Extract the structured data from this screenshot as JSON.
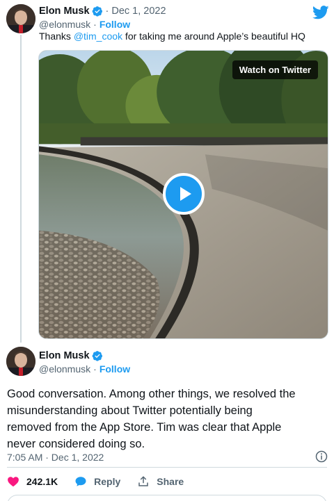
{
  "reply_tweet": {
    "author_name": "Elon Musk",
    "handle": "@elonmusk",
    "separator": "·",
    "date": "Dec 1, 2022",
    "follow_label": "Follow",
    "text_prefix": "Thanks ",
    "mention": "@tim_cook",
    "text_suffix": " for taking me around Apple’s beautiful HQ",
    "media": {
      "watch_label": "Watch on Twitter",
      "play_icon": "play-icon"
    }
  },
  "main_tweet": {
    "author_name": "Elon Musk",
    "handle": "@elonmusk",
    "separator": "·",
    "follow_label": "Follow",
    "text_lines": [
      "Good conversation. Among other things, we resolved the",
      "misunderstanding about Twitter potentially being",
      "removed from the App Store. Tim was clear that Apple",
      "never considered doing so."
    ],
    "timestamp": "7:05 AM · Dec 1, 2022"
  },
  "actions": {
    "likes": "242.1K",
    "reply_label": "Reply",
    "share_label": "Share"
  },
  "icons": {
    "logo": "twitter-bird-icon",
    "verified": "verified-badge-icon",
    "info": "info-icon",
    "like": "heart-icon",
    "reply": "reply-bubble-icon",
    "share": "share-icon"
  },
  "colors": {
    "brand": "#1d9bf0",
    "like": "#f91880",
    "text": "#0f1419",
    "muted": "#536471",
    "border": "#cfd9de"
  }
}
